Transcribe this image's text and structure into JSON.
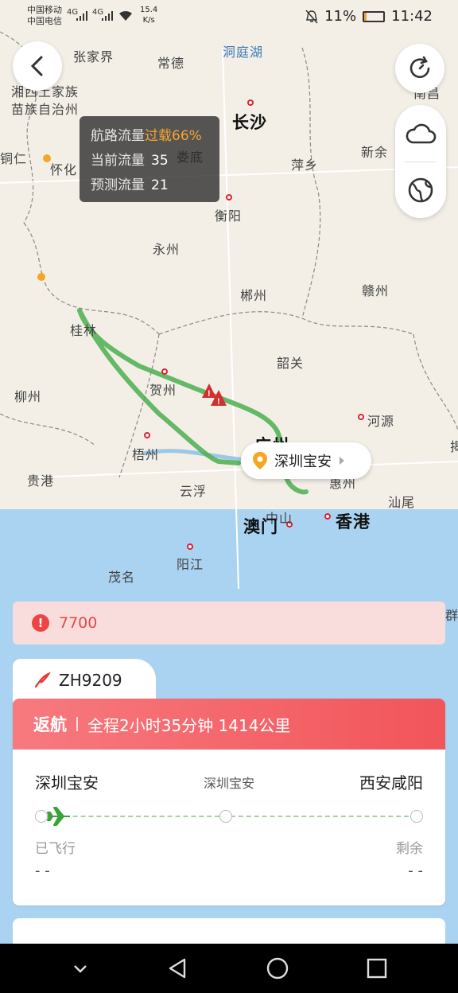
{
  "status_bar": {
    "carrier1": "中国移动",
    "carrier2": "中国电信",
    "net1": "4G",
    "net2": "4G",
    "speed_value": "15.4",
    "speed_unit": "K/s",
    "battery": "11%",
    "time": "11:42"
  },
  "map": {
    "cities": {
      "zhangjiajie": "张家界",
      "changde": "常德",
      "dongtinghu": "洞庭湖",
      "xiangxi1": "湘西土家族",
      "xiangxi2": "苗族自治州",
      "changsha": "长沙",
      "nanchang": "南昌",
      "tongren": "铜仁",
      "huaihua": "怀化",
      "loudi": "娄底",
      "pingxiang": "萍乡",
      "xinyu": "新余",
      "hengyang": "衡阳",
      "yongzhou": "永州",
      "chenzhou": "郴州",
      "ganzhou": "赣州",
      "guilin": "桂林",
      "shaoguan": "韶关",
      "hezhou": "贺州",
      "liuzhou": "柳州",
      "heyuan": "河源",
      "guangzhou": "广州",
      "wuzhou": "梧州",
      "guigang": "贵港",
      "yunfu": "云浮",
      "huizhou": "惠州",
      "shanwei": "汕尾",
      "zhongshan": "中山",
      "macau": "澳门",
      "hongkong": "香港",
      "yangjiang": "阳江",
      "maoming": "茂名",
      "jie": "揭",
      "qun": "群"
    },
    "airport_label": "深圳宝安"
  },
  "tooltip": {
    "title": "航路流量",
    "overload": "过载66%",
    "current_label": "当前流量",
    "current_value": "35",
    "forecast_label": "预测流量",
    "forecast_value": "21"
  },
  "alert": {
    "code": "7700",
    "color": "#e04a4a"
  },
  "flight": {
    "number": "ZH9209",
    "state": "返航",
    "summary": "全程2小时35分钟 1414公里",
    "from": "深圳宝安",
    "via": "深圳宝安",
    "to": "西安咸阳",
    "flown_label": "已飞行",
    "remaining_label": "剩余",
    "flown_value": "- -",
    "remaining_value": "- -",
    "header_color": "#f1555a"
  },
  "icons": {
    "back": "chevron-left-icon",
    "refresh": "refresh-icon",
    "weather": "cloud-icon",
    "layer": "globe-icon"
  }
}
